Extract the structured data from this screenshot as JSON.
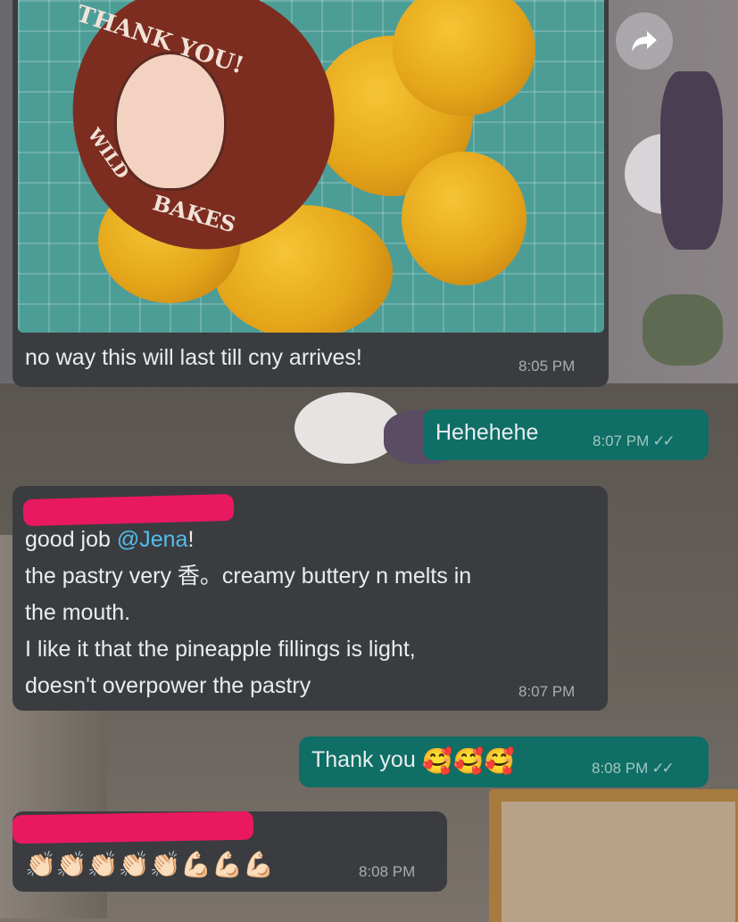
{
  "messages": {
    "m1": {
      "text": "no way this will last till cny arrives!",
      "time": "8:05 PM"
    },
    "m2": {
      "text": "Hehehehe",
      "time": "8:07 PM",
      "ticks": "✓✓"
    },
    "m3": {
      "line1_pre": "good job ",
      "mention": "@Jena",
      "line1_post": "!",
      "line2": "the pastry very 香。creamy buttery n melts in",
      "line3": "the mouth.",
      "line4": "I like it that the pineapple fillings is light,",
      "line5": "doesn't overpower the pastry",
      "time": "8:07 PM"
    },
    "m4": {
      "text": "Thank you",
      "emojis": "🥰🥰🥰",
      "time": "8:08 PM",
      "ticks": "✓✓"
    },
    "m5": {
      "emojis": "👏🏻👏🏻👏🏻👏🏻👏🏻💪🏻💪🏻💪🏻",
      "time": "8:08 PM"
    }
  },
  "image": {
    "tag_line1": "THANK YOU!",
    "tag_line2": "WILD",
    "tag_line3": "BAKES"
  },
  "icons": {
    "forward": "forward-icon",
    "read_receipt": "double-check-icon"
  },
  "colors": {
    "incoming": "#3b3c40",
    "outgoing": "#0f6e65",
    "mention": "#53bdeb",
    "redaction": "#e8195f"
  }
}
